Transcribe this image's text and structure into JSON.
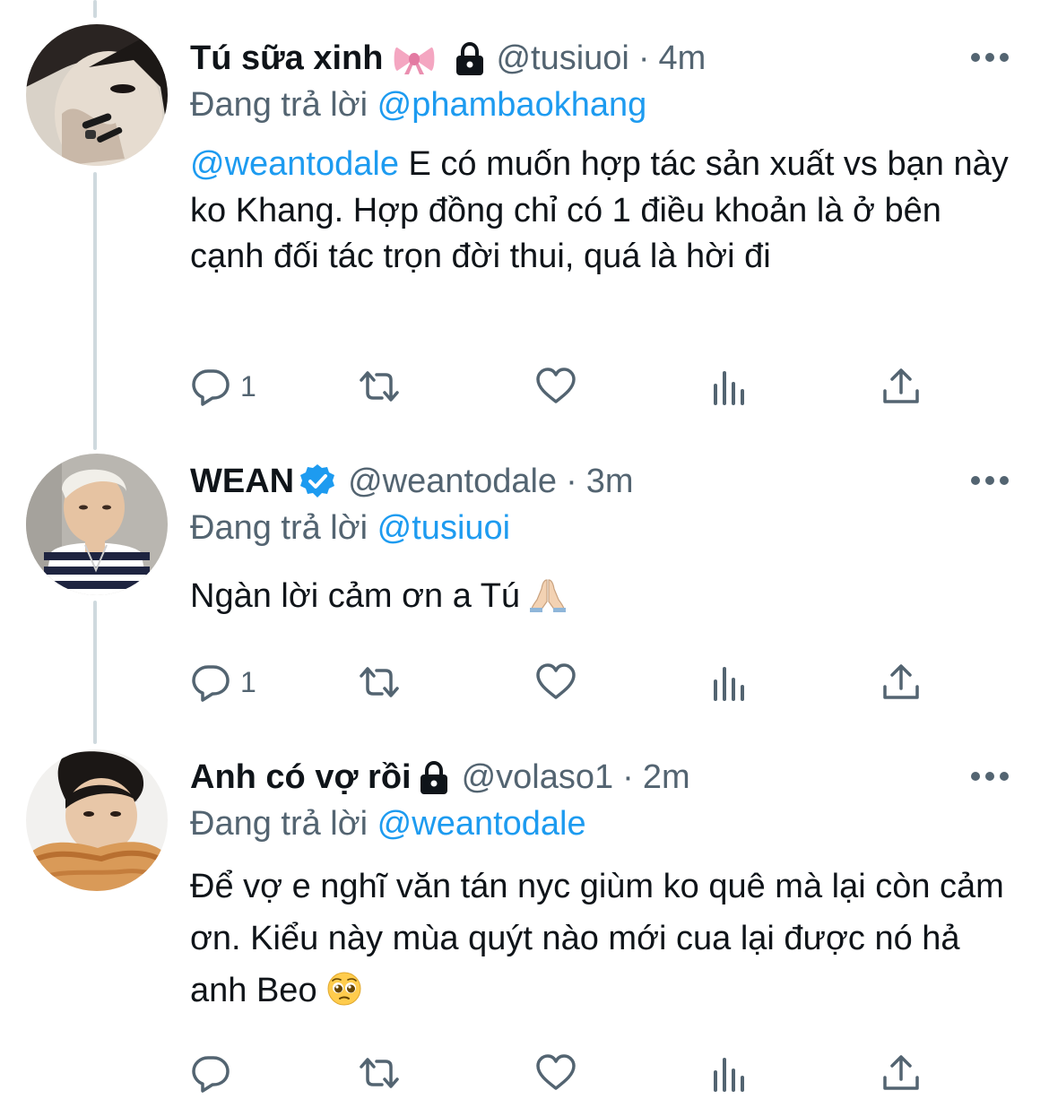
{
  "tweets": [
    {
      "display_name": "Tú sữa xinh",
      "handle": "@tusiuoi",
      "separator": "·",
      "time": "4m",
      "reply_prefix": "Đang trả lời",
      "reply_to": "@phambaokhang",
      "mention": "@weantodale",
      "text_after_mention": " E có muốn hợp tác sản xuất vs bạn này ko Khang. Hợp đồng chỉ có 1 điều khoản là ở bên cạnh đối tác trọn đời thui, quá là hời đi",
      "reply_count": "1",
      "icons": [
        "bow-icon",
        "lock-icon",
        "more-icon"
      ]
    },
    {
      "display_name": "WEAN",
      "handle": "@weantodale",
      "separator": "·",
      "time": "3m",
      "reply_prefix": "Đang trả lời",
      "reply_to": "@tusiuoi",
      "text": "Ngàn lời cảm ơn a Tú",
      "reply_count": "1",
      "icons": [
        "verified-icon",
        "praying-hands-emoji",
        "more-icon"
      ]
    },
    {
      "display_name": "Anh có vợ rồi",
      "handle": "@volaso1",
      "separator": "·",
      "time": "2m",
      "reply_prefix": "Đang trả lời",
      "reply_to": "@weantodale",
      "text": "Để vợ e nghĩ văn tán nyc giùm ko quê mà lại còn cảm ơn. Kiểu này mùa quýt nào mới cua lại được nó hả anh Beo",
      "reply_count": "",
      "icons": [
        "lock-icon",
        "pleading-face-emoji",
        "more-icon"
      ]
    }
  ],
  "colors": {
    "link": "#1d9bf0",
    "secondary_text": "#536471",
    "primary_text": "#0f1419",
    "thread_line": "#cfd9de"
  }
}
